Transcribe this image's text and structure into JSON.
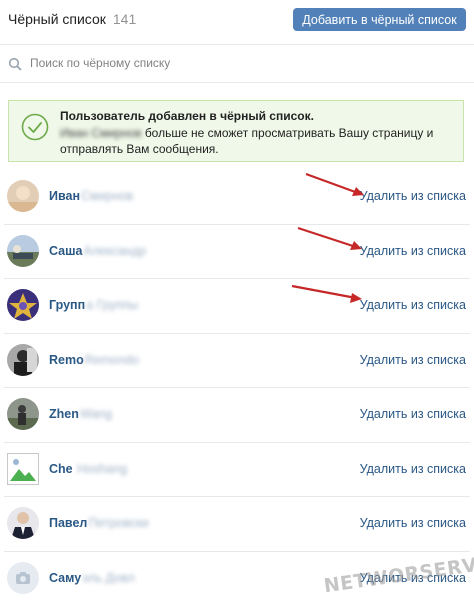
{
  "header": {
    "title": "Чёрный список",
    "count": "141",
    "add_button": "Добавить в чёрный список"
  },
  "search": {
    "placeholder": "Поиск по чёрному списку"
  },
  "notice": {
    "title": "Пользователь добавлен в чёрный список.",
    "blurred_name": "Иван Смирнов",
    "text": "больше не сможет просматривать Вашу страницу и отправлять Вам сообщения."
  },
  "list": {
    "remove_label": "Удалить из списка",
    "items": [
      {
        "name": "Иван",
        "blurred": "Смирнов"
      },
      {
        "name": "Саша",
        "blurred": "Александр"
      },
      {
        "name": "Групп",
        "blurred": "а Группы"
      },
      {
        "name": "Remo",
        "blurred": "Remondo"
      },
      {
        "name": "Zhen",
        "blurred": "Wang"
      },
      {
        "name": "Che",
        "blurred": "Hoshang"
      },
      {
        "name": "Павел",
        "blurred": "Петровски"
      },
      {
        "name": "Саму",
        "blurred": "эль Довл"
      }
    ]
  },
  "watermark": "NETWORSERVER.RU",
  "colors": {
    "accent": "#5181b8",
    "link": "#2a5885",
    "success_bg": "#f0f8e9",
    "success_border": "#c6e2ad",
    "arrow": "#c62828"
  }
}
